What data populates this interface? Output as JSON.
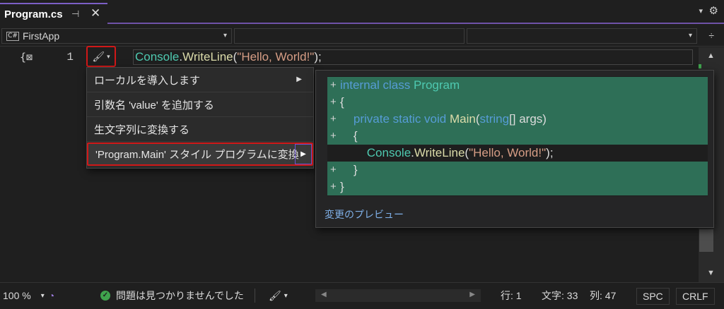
{
  "tab": {
    "title": "Program.cs",
    "pin_glyph": "⊣",
    "close_glyph": "✕"
  },
  "tabbar": {
    "dropdown_glyph": "▾",
    "settings_glyph": "⚙"
  },
  "navbar": {
    "project_icon_text": "C#",
    "project": "FirstApp",
    "caret": "▾",
    "split_glyph": "÷"
  },
  "editor": {
    "gutter_glyph": "{⊠",
    "line_number": "1",
    "lightbulb_glyph": "🖌",
    "code_tokens": [
      {
        "text": "Console",
        "kind": "t-cls"
      },
      {
        "text": ".",
        "kind": "t-pun"
      },
      {
        "text": "WriteLine",
        "kind": "t-mth"
      },
      {
        "text": "(",
        "kind": "t-pun"
      },
      {
        "text": "\"Hello, World!\"",
        "kind": "t-str"
      },
      {
        "text": ");",
        "kind": "t-pun"
      }
    ]
  },
  "menu": {
    "items": [
      {
        "label": "ローカルを導入します",
        "has_submenu": true
      },
      {
        "label": "引数名 'value' を追加する",
        "has_submenu": false
      },
      {
        "label": "生文字列に変換する",
        "has_submenu": false
      },
      {
        "label": "'Program.Main' スタイル プログラムに変換",
        "has_submenu": true,
        "selected": true
      }
    ],
    "submenu_arrow": "▶"
  },
  "preview": {
    "lines": [
      {
        "plus": "+",
        "added": true,
        "tokens": [
          {
            "text": "internal class ",
            "kind": "t-kw"
          },
          {
            "text": "Program",
            "kind": "t-cls"
          }
        ]
      },
      {
        "plus": "+",
        "added": true,
        "tokens": [
          {
            "text": "{",
            "kind": "t-pun"
          }
        ]
      },
      {
        "plus": "+",
        "added": true,
        "tokens": [
          {
            "text": "    private static void ",
            "kind": "t-kw"
          },
          {
            "text": "Main",
            "kind": "t-mth"
          },
          {
            "text": "(",
            "kind": "t-pun"
          },
          {
            "text": "string",
            "kind": "t-kw"
          },
          {
            "text": "[] args)",
            "kind": "t-pun"
          }
        ]
      },
      {
        "plus": "+",
        "added": true,
        "tokens": [
          {
            "text": "    {",
            "kind": "t-pun"
          }
        ]
      },
      {
        "plus": "",
        "added": false,
        "tokens": [
          {
            "text": "        Console",
            "kind": "t-cls"
          },
          {
            "text": ".",
            "kind": "t-pun"
          },
          {
            "text": "WriteLine",
            "kind": "t-mth"
          },
          {
            "text": "(",
            "kind": "t-pun"
          },
          {
            "text": "\"Hello, World!\"",
            "kind": "t-str"
          },
          {
            "text": ");",
            "kind": "t-pun"
          }
        ]
      },
      {
        "plus": "+",
        "added": true,
        "tokens": [
          {
            "text": "    }",
            "kind": "t-pun"
          }
        ]
      },
      {
        "plus": "+",
        "added": true,
        "tokens": [
          {
            "text": "}",
            "kind": "t-pun"
          }
        ]
      }
    ],
    "footer_link": "変更のプレビュー"
  },
  "scrollbar": {
    "up": "▲",
    "down": "▼"
  },
  "status": {
    "zoom": "100 %",
    "zoom_caret": "▾",
    "issues_icon": "✓",
    "issues": "問題は見つかりませんでした",
    "cleanup_glyph": "🖌",
    "cleanup_caret": "▾",
    "scroll_left": "◀",
    "scroll_right": "▶",
    "line": "行: 1",
    "char": "文字: 33",
    "col": "列: 47",
    "spc": "SPC",
    "eol": "CRLF"
  },
  "colors": {
    "accent": "#6f52a8",
    "highlight_border": "#d01818",
    "diff_added": "#2e6f57",
    "ok_green": "#3fa34d"
  }
}
